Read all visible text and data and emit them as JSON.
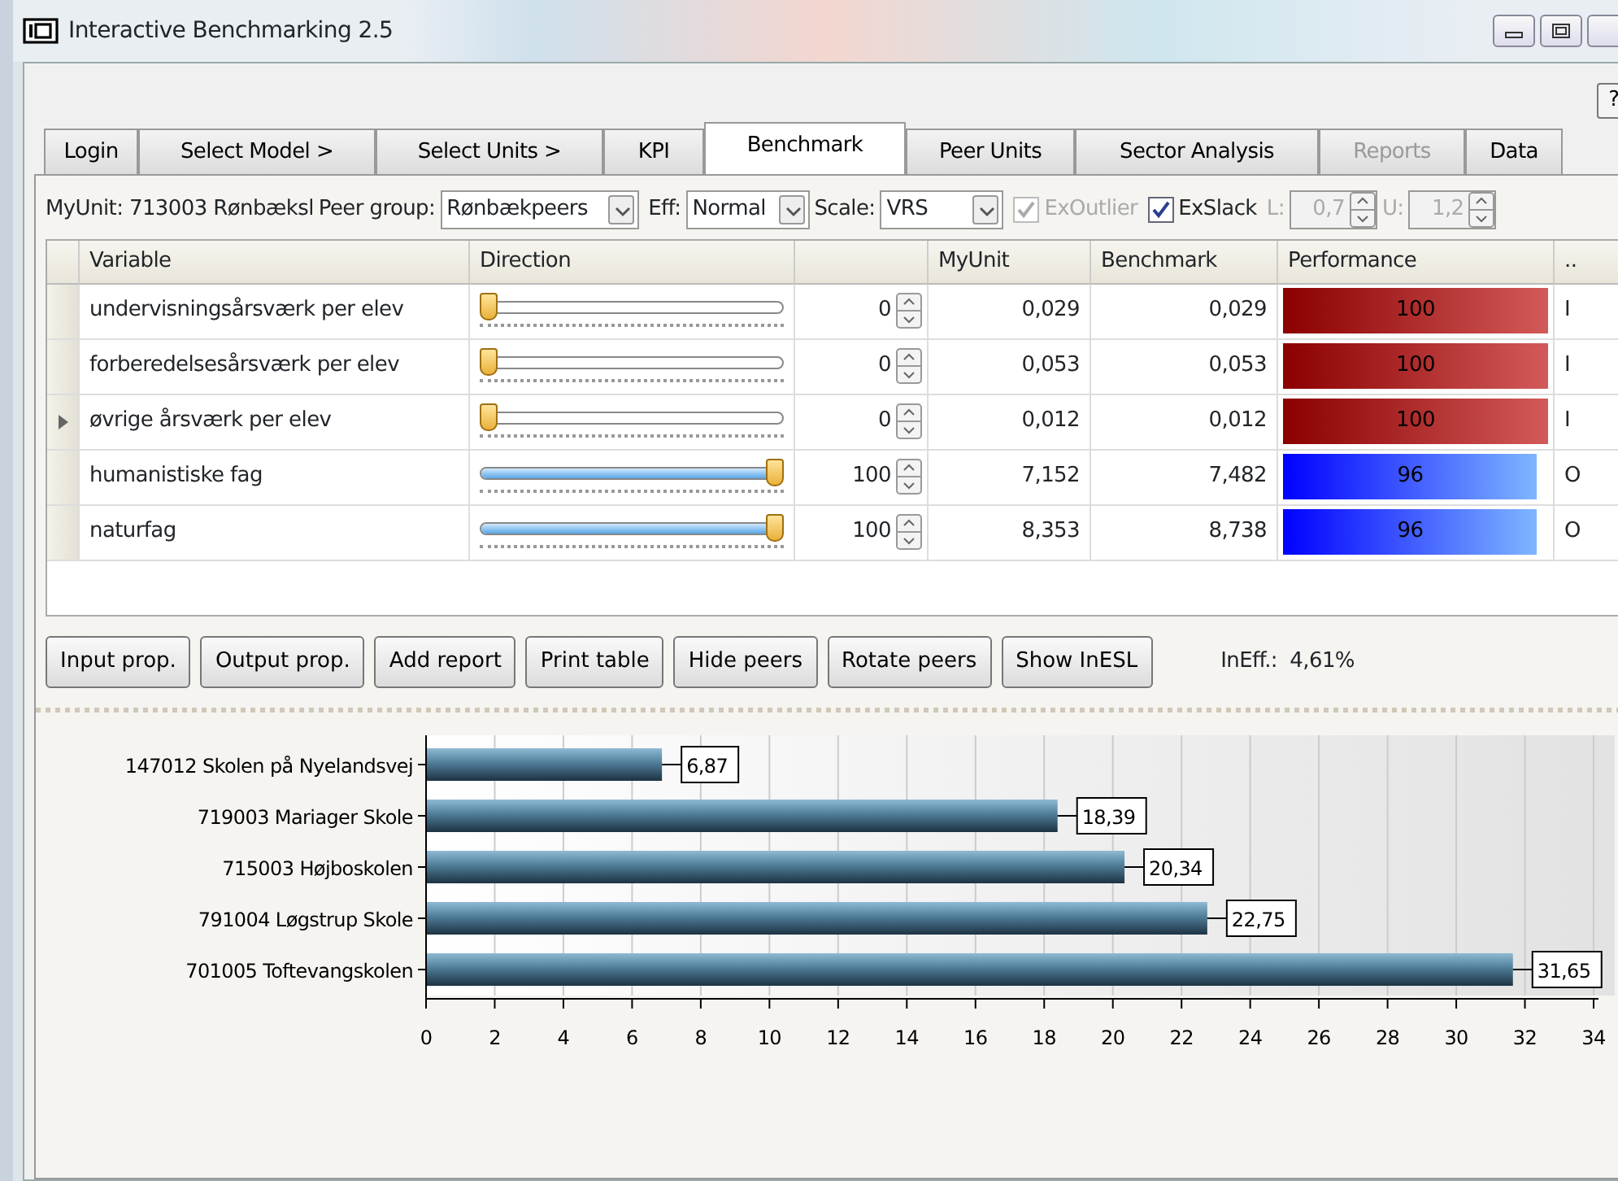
{
  "window": {
    "title": "Interactive Benchmarking 2.5",
    "help": "?"
  },
  "tabs": [
    {
      "label": "Login",
      "selected": false,
      "disabled": false
    },
    {
      "label": "Select Model >",
      "selected": false,
      "disabled": false
    },
    {
      "label": "Select Units >",
      "selected": false,
      "disabled": false
    },
    {
      "label": "KPI",
      "selected": false,
      "disabled": false
    },
    {
      "label": "Benchmark",
      "selected": true,
      "disabled": false
    },
    {
      "label": "Peer Units",
      "selected": false,
      "disabled": false
    },
    {
      "label": "Sector Analysis",
      "selected": false,
      "disabled": false
    },
    {
      "label": "Reports",
      "selected": false,
      "disabled": true
    },
    {
      "label": "Data",
      "selected": false,
      "disabled": false
    }
  ],
  "toolbar": {
    "my_unit": "MyUnit: 713003 Rønbæksl",
    "peer_group_label": "Peer group:",
    "peer_group": "Rønbækpeers",
    "eff_label": "Eff:",
    "eff": "Normal",
    "scale_label": "Scale:",
    "scale": "VRS",
    "checks": [
      {
        "label": "ExOutlier",
        "checked": true,
        "disabled": true
      },
      {
        "label": "ExSlack",
        "checked": true,
        "disabled": false
      }
    ],
    "l_label": "L:",
    "l_value": "0,7",
    "u_label": "U:",
    "u_value": "1,2",
    "limits_disabled": true
  },
  "table": {
    "columns": [
      "Variable",
      "Direction",
      "MyUnit",
      "Benchmark",
      "Performance",
      ".."
    ],
    "rows": [
      {
        "variable": "undervisningsårsværk per elev",
        "direction": {
          "level": 0
        },
        "weight": "0",
        "myunit": "0,029",
        "benchmark": "0,029",
        "performance": "100",
        "performance_bar": {
          "level": 1
        },
        "kind": "input",
        "column_8": "I",
        "current": false
      },
      {
        "variable": "forberedelsesårsværk per elev",
        "direction": {
          "level": 0
        },
        "weight": "0",
        "myunit": "0,053",
        "benchmark": "0,053",
        "performance": "100",
        "performance_bar": {
          "level": 1
        },
        "kind": "input",
        "column_8": "I",
        "current": false
      },
      {
        "variable": "øvrige årsværk per elev",
        "direction": {
          "level": 0
        },
        "weight": "0",
        "myunit": "0,012",
        "benchmark": "0,012",
        "performance": "100",
        "performance_bar": {
          "level": 1
        },
        "kind": "input",
        "column_8": "I",
        "current": true
      },
      {
        "variable": "humanistiske fag",
        "direction": {
          "level": 1
        },
        "weight": "100",
        "myunit": "7,152",
        "benchmark": "7,482",
        "performance": "96",
        "performance_bar": {
          "level": 0.96
        },
        "kind": "output",
        "column_8": "O",
        "current": false
      },
      {
        "variable": "naturfag",
        "direction": {
          "level": 1
        },
        "weight": "100",
        "myunit": "8,353",
        "benchmark": "8,738",
        "performance": "96",
        "performance_bar": {
          "level": 0.96
        },
        "kind": "output",
        "column_8": "O",
        "current": false
      }
    ]
  },
  "buttons": [
    "Input prop.",
    "Output prop.",
    "Add report",
    "Print table",
    "Hide peers",
    "Rotate peers",
    "Show InESL"
  ],
  "ineff": "InEff.:  4,61%",
  "chart": {
    "chart_data": {
      "type": "bar",
      "orientation": "horizontal",
      "categories": [
        "147012 Skolen på Nyelandsvej",
        "719003 Mariager Skole",
        "715003 Højboskolen",
        "791004 Løgstrup Skole",
        "701005 Toftevangskolen"
      ],
      "values": [
        6.87,
        18.39,
        20.34,
        22.75,
        31.65
      ],
      "value_labels": [
        "6,87",
        "18,39",
        "20,34",
        "22,75",
        "31,65"
      ],
      "xlim": [
        0,
        34
      ],
      "grid": true,
      "xticks": [
        0,
        2,
        4,
        6,
        8,
        10,
        12,
        14,
        16,
        18,
        20,
        22,
        24,
        26,
        28,
        30,
        32,
        34
      ]
    }
  }
}
